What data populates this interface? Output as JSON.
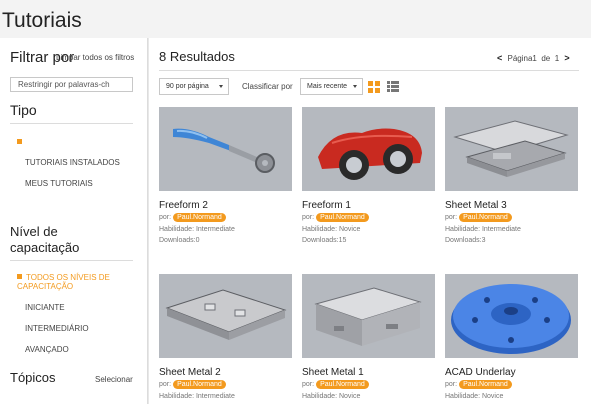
{
  "page": {
    "title": "Tutoriais"
  },
  "sidebar": {
    "filter_title": "Filtrar por",
    "clear_filters": "Limpar todos os filtros",
    "search_placeholder": "Restringir por palavras-ch",
    "type_section": {
      "title": "Tipo",
      "items": [
        {
          "label": "TUTORIAIS INSTALADOS"
        },
        {
          "label": "MEUS TUTORIAIS"
        }
      ]
    },
    "level_section": {
      "title": "Nível de capacitação",
      "items": [
        {
          "label": "TODOS OS NÍVEIS DE CAPACITAÇÃO",
          "active": true
        },
        {
          "label": "INICIANTE"
        },
        {
          "label": "INTERMEDIÁRIO"
        },
        {
          "label": "AVANÇADO"
        }
      ]
    },
    "topics_section": {
      "title": "Tópicos",
      "select_label": "Selecionar"
    }
  },
  "main": {
    "results_label": "8 Resultados",
    "pager": {
      "prefix": "Página",
      "current": "1",
      "separator": "de",
      "total": "1"
    },
    "per_page": "90 por página",
    "sort_label": "Classificar por",
    "sort_value": "Mais recente",
    "colors": {
      "accent": "#f39a1e"
    },
    "cards": [
      {
        "title": "Freeform 2",
        "by": "por:",
        "author": "Paul.Normand",
        "skill": "Habilidade: Intermediate",
        "downloads": "Downloads:0"
      },
      {
        "title": "Freeform 1",
        "by": "por:",
        "author": "Paul.Normand",
        "skill": "Habilidade: Novice",
        "downloads": "Downloads:15"
      },
      {
        "title": "Sheet Metal 3",
        "by": "por:",
        "author": "Paul.Normand",
        "skill": "Habilidade: Intermediate",
        "downloads": "Downloads:3"
      },
      {
        "title": "Sheet Metal 2",
        "by": "por:",
        "author": "Paul.Normand",
        "skill": "Habilidade: Intermediate"
      },
      {
        "title": "Sheet Metal 1",
        "by": "por:",
        "author": "Paul.Normand",
        "skill": "Habilidade: Novice"
      },
      {
        "title": "ACAD Underlay",
        "by": "por:",
        "author": "Paul.Normand",
        "skill": "Habilidade: Novice"
      }
    ]
  }
}
